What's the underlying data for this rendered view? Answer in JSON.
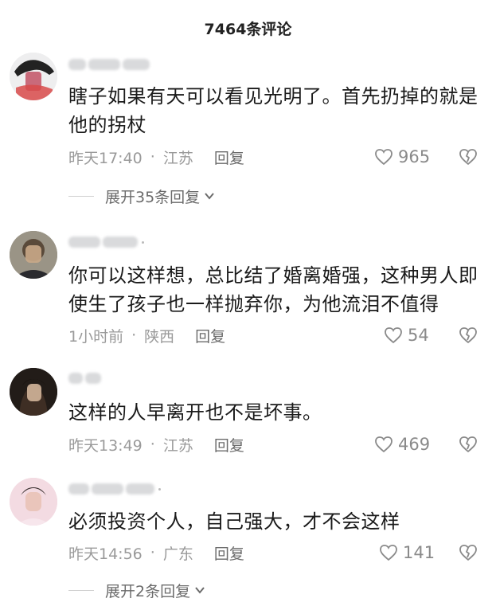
{
  "header": {
    "title": "7464条评论"
  },
  "comments": [
    {
      "text": "瞎子如果有天可以看见光明了。首先扔掉的就是他的拐杖",
      "time": "昨天17:40",
      "location": "江苏",
      "reply_label": "回复",
      "likes": "965",
      "expand_label": "展开35条回复",
      "avatar_color": "#e8e8ea"
    },
    {
      "text": "你可以这样想，总比结了婚离婚强，这种男人即使生了孩子也一样抛弃你，为他流泪不值得",
      "time": "1小时前",
      "location": "陕西",
      "reply_label": "回复",
      "likes": "54",
      "avatar_color": "#8d8b7e"
    },
    {
      "text": "这样的人早离开也不是坏事。",
      "time": "昨天13:49",
      "location": "江苏",
      "reply_label": "回复",
      "likes": "469",
      "avatar_color": "#2b2420"
    },
    {
      "text": "必须投资个人，自己强大，才不会这样",
      "time": "昨天14:56",
      "location": "广东",
      "reply_label": "回复",
      "likes": "141",
      "expand_label": "展开2条回复",
      "avatar_color": "#f2d6df"
    }
  ],
  "icons": {
    "like": "heart-outline-icon",
    "dislike": "broken-heart-icon",
    "expand": "chevron-down-icon"
  }
}
